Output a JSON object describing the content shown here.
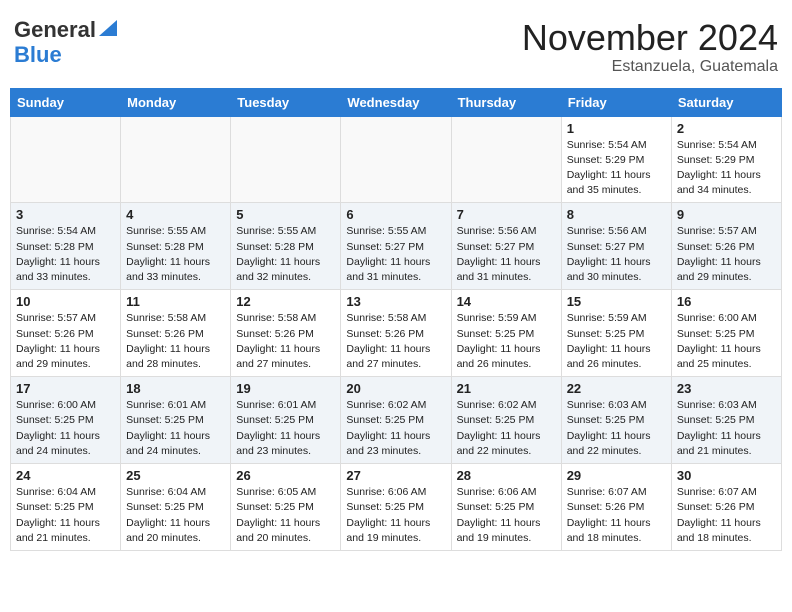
{
  "header": {
    "logo_general": "General",
    "logo_blue": "Blue",
    "month_year": "November 2024",
    "location": "Estanzuela, Guatemala"
  },
  "days_of_week": [
    "Sunday",
    "Monday",
    "Tuesday",
    "Wednesday",
    "Thursday",
    "Friday",
    "Saturday"
  ],
  "weeks": [
    [
      {
        "day": "",
        "info": ""
      },
      {
        "day": "",
        "info": ""
      },
      {
        "day": "",
        "info": ""
      },
      {
        "day": "",
        "info": ""
      },
      {
        "day": "",
        "info": ""
      },
      {
        "day": "1",
        "info": "Sunrise: 5:54 AM\nSunset: 5:29 PM\nDaylight: 11 hours and 35 minutes."
      },
      {
        "day": "2",
        "info": "Sunrise: 5:54 AM\nSunset: 5:29 PM\nDaylight: 11 hours and 34 minutes."
      }
    ],
    [
      {
        "day": "3",
        "info": "Sunrise: 5:54 AM\nSunset: 5:28 PM\nDaylight: 11 hours and 33 minutes."
      },
      {
        "day": "4",
        "info": "Sunrise: 5:55 AM\nSunset: 5:28 PM\nDaylight: 11 hours and 33 minutes."
      },
      {
        "day": "5",
        "info": "Sunrise: 5:55 AM\nSunset: 5:28 PM\nDaylight: 11 hours and 32 minutes."
      },
      {
        "day": "6",
        "info": "Sunrise: 5:55 AM\nSunset: 5:27 PM\nDaylight: 11 hours and 31 minutes."
      },
      {
        "day": "7",
        "info": "Sunrise: 5:56 AM\nSunset: 5:27 PM\nDaylight: 11 hours and 31 minutes."
      },
      {
        "day": "8",
        "info": "Sunrise: 5:56 AM\nSunset: 5:27 PM\nDaylight: 11 hours and 30 minutes."
      },
      {
        "day": "9",
        "info": "Sunrise: 5:57 AM\nSunset: 5:26 PM\nDaylight: 11 hours and 29 minutes."
      }
    ],
    [
      {
        "day": "10",
        "info": "Sunrise: 5:57 AM\nSunset: 5:26 PM\nDaylight: 11 hours and 29 minutes."
      },
      {
        "day": "11",
        "info": "Sunrise: 5:58 AM\nSunset: 5:26 PM\nDaylight: 11 hours and 28 minutes."
      },
      {
        "day": "12",
        "info": "Sunrise: 5:58 AM\nSunset: 5:26 PM\nDaylight: 11 hours and 27 minutes."
      },
      {
        "day": "13",
        "info": "Sunrise: 5:58 AM\nSunset: 5:26 PM\nDaylight: 11 hours and 27 minutes."
      },
      {
        "day": "14",
        "info": "Sunrise: 5:59 AM\nSunset: 5:25 PM\nDaylight: 11 hours and 26 minutes."
      },
      {
        "day": "15",
        "info": "Sunrise: 5:59 AM\nSunset: 5:25 PM\nDaylight: 11 hours and 26 minutes."
      },
      {
        "day": "16",
        "info": "Sunrise: 6:00 AM\nSunset: 5:25 PM\nDaylight: 11 hours and 25 minutes."
      }
    ],
    [
      {
        "day": "17",
        "info": "Sunrise: 6:00 AM\nSunset: 5:25 PM\nDaylight: 11 hours and 24 minutes."
      },
      {
        "day": "18",
        "info": "Sunrise: 6:01 AM\nSunset: 5:25 PM\nDaylight: 11 hours and 24 minutes."
      },
      {
        "day": "19",
        "info": "Sunrise: 6:01 AM\nSunset: 5:25 PM\nDaylight: 11 hours and 23 minutes."
      },
      {
        "day": "20",
        "info": "Sunrise: 6:02 AM\nSunset: 5:25 PM\nDaylight: 11 hours and 23 minutes."
      },
      {
        "day": "21",
        "info": "Sunrise: 6:02 AM\nSunset: 5:25 PM\nDaylight: 11 hours and 22 minutes."
      },
      {
        "day": "22",
        "info": "Sunrise: 6:03 AM\nSunset: 5:25 PM\nDaylight: 11 hours and 22 minutes."
      },
      {
        "day": "23",
        "info": "Sunrise: 6:03 AM\nSunset: 5:25 PM\nDaylight: 11 hours and 21 minutes."
      }
    ],
    [
      {
        "day": "24",
        "info": "Sunrise: 6:04 AM\nSunset: 5:25 PM\nDaylight: 11 hours and 21 minutes."
      },
      {
        "day": "25",
        "info": "Sunrise: 6:04 AM\nSunset: 5:25 PM\nDaylight: 11 hours and 20 minutes."
      },
      {
        "day": "26",
        "info": "Sunrise: 6:05 AM\nSunset: 5:25 PM\nDaylight: 11 hours and 20 minutes."
      },
      {
        "day": "27",
        "info": "Sunrise: 6:06 AM\nSunset: 5:25 PM\nDaylight: 11 hours and 19 minutes."
      },
      {
        "day": "28",
        "info": "Sunrise: 6:06 AM\nSunset: 5:25 PM\nDaylight: 11 hours and 19 minutes."
      },
      {
        "day": "29",
        "info": "Sunrise: 6:07 AM\nSunset: 5:26 PM\nDaylight: 11 hours and 18 minutes."
      },
      {
        "day": "30",
        "info": "Sunrise: 6:07 AM\nSunset: 5:26 PM\nDaylight: 11 hours and 18 minutes."
      }
    ]
  ]
}
